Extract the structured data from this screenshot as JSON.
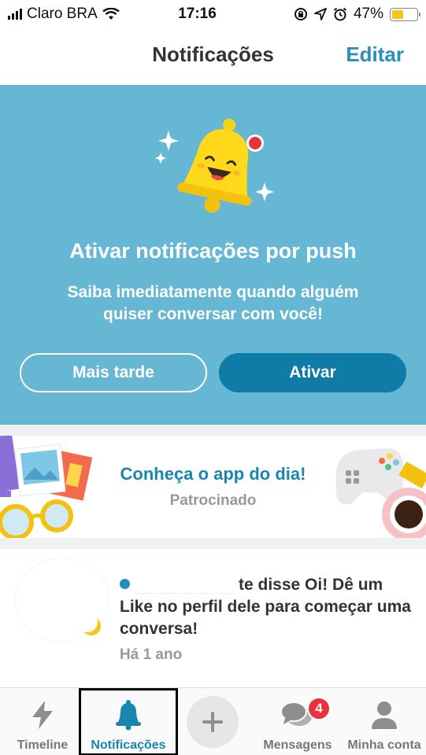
{
  "status_bar": {
    "carrier": "Claro BRA",
    "time": "17:16",
    "battery_percent": "47%",
    "battery_level": 0.47,
    "icons": [
      "signal-icon",
      "wifi-icon",
      "rotation-lock-icon",
      "location-icon",
      "alarm-icon",
      "battery-icon"
    ]
  },
  "nav": {
    "title": "Notificações",
    "edit_label": "Editar"
  },
  "push_card": {
    "title": "Ativar notificações por push",
    "subtitle_line1": "Saiba imediatamente quando alguém",
    "subtitle_line2": "quiser conversar com você!",
    "later_label": "Mais tarde",
    "enable_label": "Ativar",
    "icon": "smiling-bell-icon",
    "bg_color": "#65b7d4"
  },
  "ad_card": {
    "title": "Conheça o app do dia!",
    "sponsored_label": "Patrocinado"
  },
  "notification": {
    "message": "te disse Oi! Dê um Like no perfil dele para começar uma conversa!",
    "time": "Há 1 ano"
  },
  "tab_bar": {
    "items": [
      {
        "label": "Timeline",
        "icon": "lightning-icon",
        "active": false
      },
      {
        "label": "Notificações",
        "icon": "bell-icon",
        "active": true
      },
      {
        "label": "",
        "icon": "plus-icon",
        "active": false
      },
      {
        "label": "Mensagens",
        "icon": "chat-bubbles-icon",
        "active": false,
        "badge": "4"
      },
      {
        "label": "Minha conta",
        "icon": "person-icon",
        "active": false
      }
    ],
    "accent_color": "#1a85ad"
  }
}
